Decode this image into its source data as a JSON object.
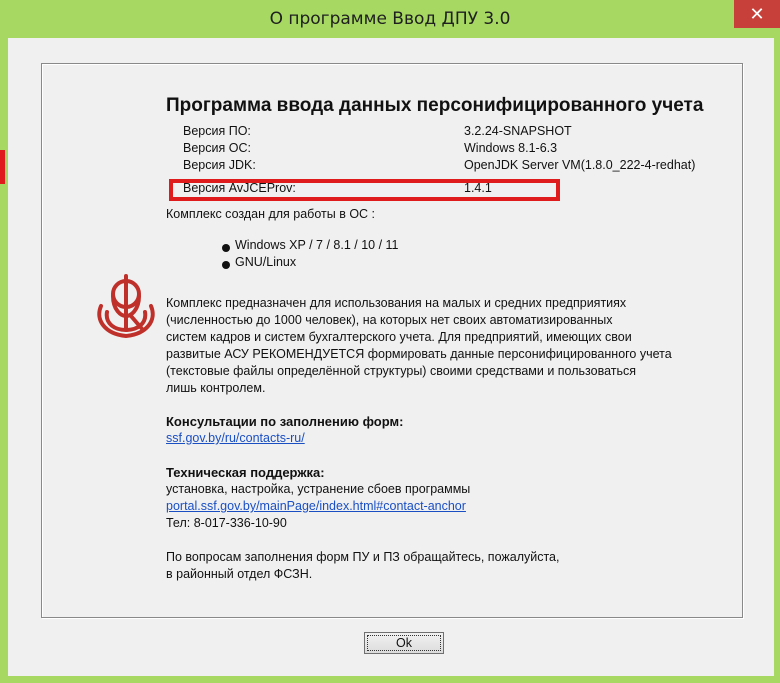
{
  "window": {
    "title": "О программе Ввод ДПУ 3.0",
    "close_label": "✕"
  },
  "about": {
    "heading": "Программа ввода данных персонифицированного учета",
    "versions": [
      {
        "label": "Версия ПО:",
        "value": "3.2.24-SNAPSHOT"
      },
      {
        "label": "Версия ОС:",
        "value": "Windows 8.1-6.3"
      },
      {
        "label": "Версия JDK:",
        "value": "OpenJDK Server VM(1.8.0_222-4-redhat)"
      },
      {
        "label": "Версия AvJCEProv:",
        "value": "1.4.1"
      }
    ],
    "os_intro": "Комплекс создан для работы в ОС :",
    "os_list": [
      "Windows XP / 7 / 8.1 / 10 / 11",
      "GNU/Linux"
    ],
    "description_lines": [
      "Комплекс предназначен для использования на малых и средних предприятиях",
      "(численностью до 1000 человек), на которых нет своих автоматизированных",
      "систем кадров и систем бухгалтерского учета. Для предприятий, имеющих свои",
      "развитые АСУ РЕКОМЕНДУЕТСЯ формировать данные персонифицированного учета",
      "(текстовые файлы определённой структуры) своими средствами и пользоваться",
      "лишь контролем."
    ],
    "consult_title": "Консультации по заполнению форм:",
    "consult_link": "ssf.gov.by/ru/contacts-ru/",
    "support_title": "Техническая поддержка:",
    "support_desc": "установка, настройка, устранение сбоев программы",
    "support_link": "portal.ssf.gov.by/mainPage/index.html#contact-anchor",
    "support_phone": "Тел: 8-017-336-10-90",
    "footer_lines": [
      "По вопросам заполнения форм ПУ и ПЗ обращайтесь, пожалуйста,",
      "в районный отдел ФСЗН."
    ]
  },
  "buttons": {
    "ok": "Ok"
  },
  "colors": {
    "window_frame": "#a6d862",
    "close_button": "#c7403a",
    "highlight": "#e01b1b",
    "logo": "#c0302a",
    "link": "#1a4fc4"
  },
  "icons": {
    "logo": "fszn-emblem-icon",
    "close": "close-icon"
  }
}
